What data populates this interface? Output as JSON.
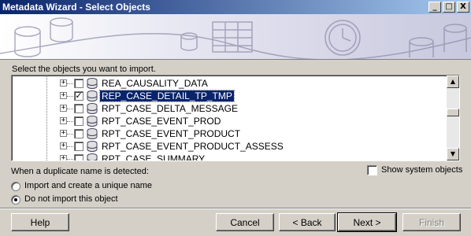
{
  "window": {
    "title": "Metadata Wizard - Select Objects",
    "controls": [
      "_",
      "□",
      "X"
    ]
  },
  "prompt": "Select the objects you want to import.",
  "tree": {
    "items": [
      {
        "label": "REA_CAUSALITY_DATA",
        "checked": false,
        "selected": false
      },
      {
        "label": "REP_CASE_DETAIL_TP_TMP",
        "checked": true,
        "selected": true
      },
      {
        "label": "RPT_CASE_DELTA_MESSAGE",
        "checked": false,
        "selected": false
      },
      {
        "label": "RPT_CASE_EVENT_PROD",
        "checked": false,
        "selected": false
      },
      {
        "label": "RPT_CASE_EVENT_PRODUCT",
        "checked": false,
        "selected": false
      },
      {
        "label": "RPT_CASE_EVENT_PRODUCT_ASSESS",
        "checked": false,
        "selected": false
      },
      {
        "label": "RPT_CASE_SUMMARY",
        "checked": false,
        "selected": false
      }
    ]
  },
  "duplicate": {
    "heading": "When a duplicate name is detected:",
    "option1": "Import and create a unique name",
    "option2": "Do not import this object",
    "selected": "option2"
  },
  "show_system": {
    "label": "Show system objects",
    "checked": false
  },
  "buttons": {
    "help": "Help",
    "cancel": "Cancel",
    "back": "< Back",
    "next": "Next >",
    "finish": "Finish"
  },
  "colors": {
    "selection": "#0a246a",
    "titlebar": "#0a246a",
    "face": "#d4d0c8"
  }
}
